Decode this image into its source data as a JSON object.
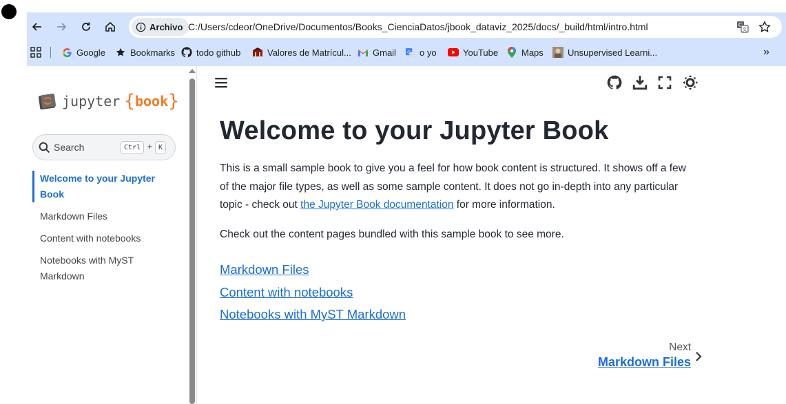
{
  "browser": {
    "chip_label": "Archivo",
    "url": "C:/Users/cdeor/OneDrive/Documentos/Books_CienciaDatos/jbook_dataviz_2025/docs/_build/html/intro.html",
    "bookmarks": [
      {
        "label": "Google",
        "icon": "google-icon"
      },
      {
        "label": "Bookmarks",
        "icon": "star-icon"
      },
      {
        "label": "todo github",
        "icon": "github-icon"
      },
      {
        "label": "Valores de Matrícul...",
        "icon": "school-icon"
      },
      {
        "label": "Gmail",
        "icon": "gmail-icon"
      },
      {
        "label": "o yo",
        "icon": "google-translate-icon"
      },
      {
        "label": "YouTube",
        "icon": "youtube-icon"
      },
      {
        "label": "Maps",
        "icon": "maps-icon"
      },
      {
        "label": "Unsupervised Learni...",
        "icon": "thumbnail-icon"
      }
    ],
    "overflow_label": "»"
  },
  "sidebar": {
    "logo_text": "jupyter",
    "logo_brace_left": "{",
    "logo_brace_text": "book",
    "logo_brace_right": "}",
    "search_placeholder": "Search",
    "search_key1": "Ctrl",
    "search_plus": "+",
    "search_key2": "K",
    "toc": [
      {
        "label": "Welcome to your Jupyter Book",
        "active": true
      },
      {
        "label": "Markdown Files",
        "active": false
      },
      {
        "label": "Content with notebooks",
        "active": false
      },
      {
        "label": "Notebooks with MyST Markdown",
        "active": false
      }
    ]
  },
  "main": {
    "title": "Welcome to your Jupyter Book",
    "para1_before": "This is a small sample book to give you a feel for how book content is structured. It shows off a few of the major file types, as well as some sample content. It does not go in-depth into any particular topic - check out ",
    "para1_link": "the Jupyter Book documentation",
    "para1_after": " for more information.",
    "para2": "Check out the content pages bundled with this sample book to see more.",
    "links": [
      "Markdown Files",
      "Content with notebooks",
      "Notebooks with MyST Markdown"
    ],
    "next_label": "Next",
    "next_title": "Markdown Files"
  },
  "colors": {
    "chrome_bg": "#d3e3fd",
    "link": "#1a6ed8",
    "brand_orange": "#f37726",
    "text": "#222832"
  }
}
